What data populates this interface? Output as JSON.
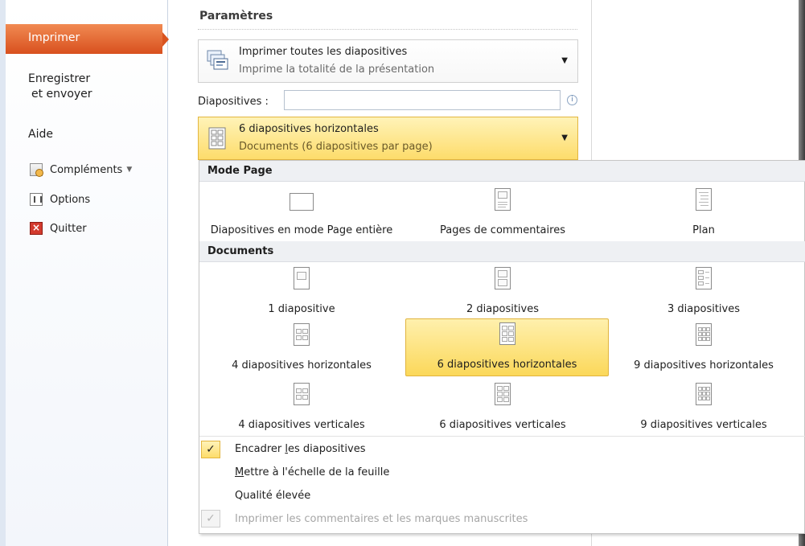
{
  "nav": {
    "active_label": "Imprimer",
    "save_send_line1": "Enregistrer",
    "save_send_line2": "et envoyer",
    "help": "Aide",
    "addins": "Compléments",
    "options": "Options",
    "quit": "Quitter"
  },
  "settings": {
    "title": "Paramètres",
    "print_combo": {
      "line1": "Imprimer toutes les diapositives",
      "line2": "Imprime la totalité de la présentation"
    },
    "slides_label": "Diapositives :",
    "slides_value": "",
    "layout_combo": {
      "line1": "6 diapositives horizontales",
      "line2": "Documents (6 diapositives par page)"
    }
  },
  "dropdown": {
    "group1": "Mode Page",
    "group1_items": [
      "Diapositives en mode Page entière",
      "Pages de commentaires",
      "Plan"
    ],
    "group2": "Documents",
    "group2_items": [
      "1 diapositive",
      "2 diapositives",
      "3 diapositives",
      "4 diapositives horizontales",
      "6 diapositives horizontales",
      "9 diapositives horizontales",
      "4 diapositives verticales",
      "6 diapositives verticales",
      "9 diapositives verticales"
    ],
    "selected_item": "6 diapositives horizontales",
    "frame_slides_prefix": "Encadrer ",
    "frame_slides_underlined": "l",
    "frame_slides_suffix": "es diapositives",
    "scale_underlined": "M",
    "scale_suffix": "ettre à l'échelle de la feuille",
    "high_quality": "Qualité élevée",
    "print_comments": "Imprimer les commentaires et les marques manuscrites",
    "check_mark": "✓"
  }
}
